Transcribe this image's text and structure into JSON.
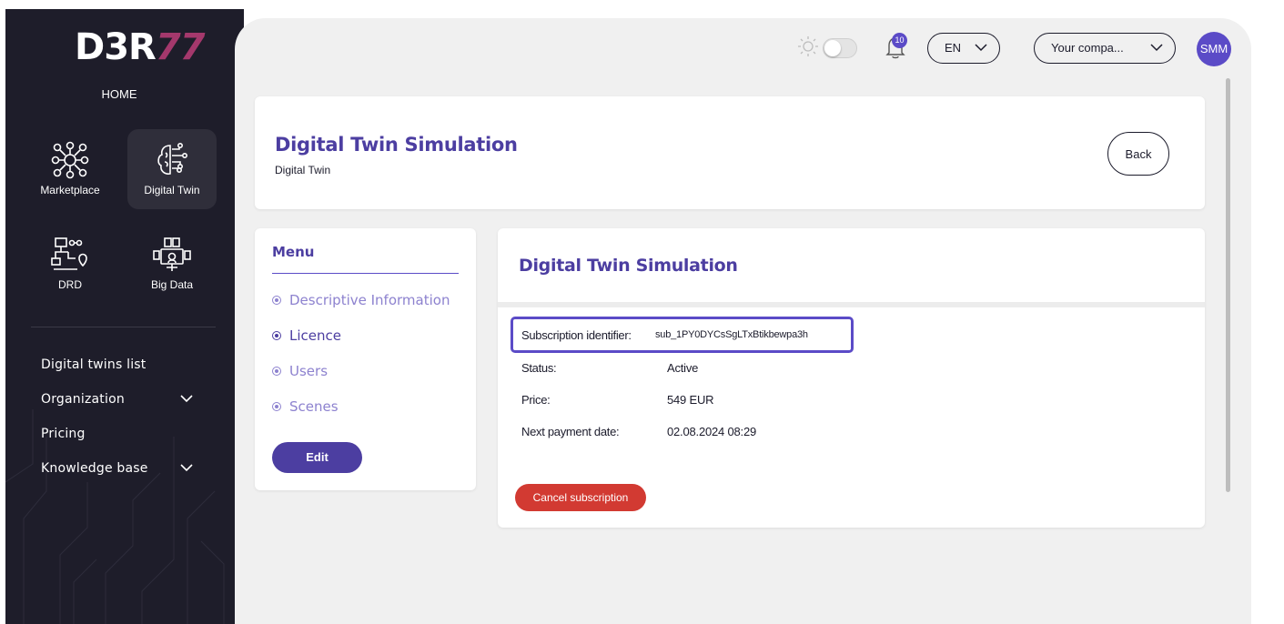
{
  "brand": {
    "logo_main": "D3R",
    "logo_accent": "77",
    "accent_color": "#a4386c"
  },
  "sidebar": {
    "home_label": "HOME",
    "modules": [
      {
        "label": "Marketplace",
        "icon": "marketplace-network-icon"
      },
      {
        "label": "Digital Twin",
        "icon": "digital-twin-brain-icon",
        "active": true
      },
      {
        "label": "DRD",
        "icon": "drd-flow-icon"
      },
      {
        "label": "Big Data",
        "icon": "big-data-icon"
      }
    ],
    "nav": [
      {
        "label": "Digital twins list"
      },
      {
        "label": "Organization",
        "expandable": true
      },
      {
        "label": "Pricing"
      },
      {
        "label": "Knowledge base",
        "expandable": true
      }
    ]
  },
  "topbar": {
    "theme_icon": "sun-icon",
    "notifications_count": "10",
    "language": "EN",
    "company_placeholder": "Your compa...",
    "avatar_initials": "SMM"
  },
  "header": {
    "title": "Digital Twin Simulation",
    "subtitle": "Digital Twin",
    "back_label": "Back"
  },
  "menu": {
    "title": "Menu",
    "items": [
      {
        "label": "Descriptive Information"
      },
      {
        "label": "Licence",
        "active": true
      },
      {
        "label": "Users"
      },
      {
        "label": "Scenes"
      }
    ],
    "edit_label": "Edit"
  },
  "detail": {
    "title": "Digital Twin Simulation",
    "rows": [
      {
        "label": "Subscription identifier:",
        "value": "sub_1PY0DYCsSgLTxBtikbewpa3h"
      },
      {
        "label": "Status:",
        "value": "Active"
      },
      {
        "label": "Price:",
        "value": "549 EUR"
      },
      {
        "label": "Next payment date:",
        "value": "02.08.2024 08:29"
      }
    ],
    "cancel_label": "Cancel subscription"
  },
  "colors": {
    "primary": "#4c3ea1",
    "primary_light": "#8d82cf",
    "danger": "#d23a32",
    "sidebar_bg": "#1e1d2a",
    "highlight_border": "#5b4bc7"
  }
}
